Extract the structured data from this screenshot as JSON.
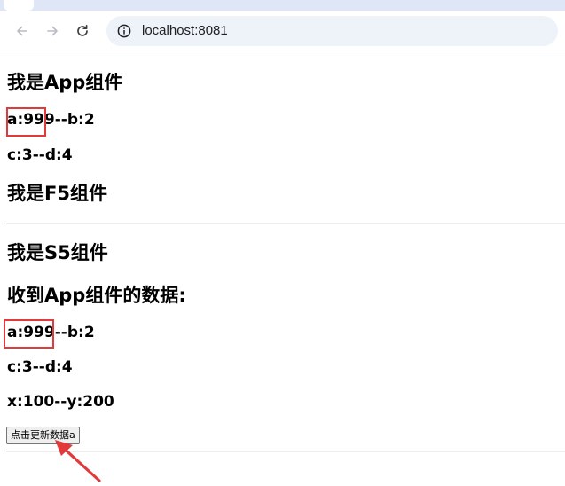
{
  "browser": {
    "url": "localhost:8081",
    "icons": {
      "back": "arrow-left-icon",
      "forward": "arrow-right-icon",
      "reload": "reload-icon",
      "site_info": "info-icon"
    }
  },
  "app": {
    "title": "我是App组件",
    "ab_line": "a:999--b:2",
    "cd_line": "c:3--d:4"
  },
  "f5": {
    "title": "我是F5组件"
  },
  "s5": {
    "title": "我是S5组件",
    "received_title": "收到App组件的数据:",
    "ab_line": "a:999--b:2",
    "cd_line": "c:3--d:4",
    "xy_line": "x:100--y:200",
    "update_button_label": "点击更新数据a"
  },
  "annotations": {
    "color": "#e23a3a"
  }
}
